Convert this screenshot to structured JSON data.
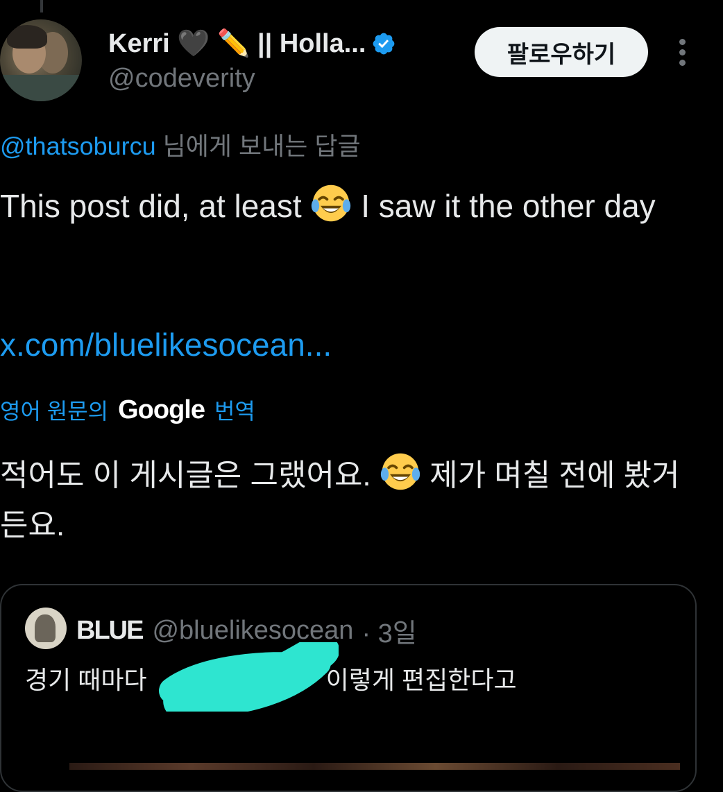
{
  "author": {
    "display_name": "Kerri 🖤 ✏️ || Holla...",
    "handle": "@codeverity",
    "verified": true
  },
  "actions": {
    "follow_label": "팔로우하기",
    "more_icon": "more-vertical-icon"
  },
  "reply": {
    "mention": "@thatsoburcu",
    "suffix": " 님에게 보내는 답글"
  },
  "tweet": {
    "text_part1": "This post did, at least ",
    "emoji": "face-with-tears-of-joy",
    "text_part2": " I saw it the other day",
    "link": "x.com/bluelikesocean..."
  },
  "translation": {
    "prefix": "영어 원문의",
    "brand": "Google",
    "suffix": "번역",
    "text_part1": "적어도 이 게시글은 그랬어요. ",
    "text_part2": " 제가 며칠 전에 봤거든요."
  },
  "quote": {
    "name": "BLUE",
    "handle": "@bluelikesocean",
    "time": "· 3일",
    "text_before": "경기 때마다",
    "text_after": "이렇게 편집한다고",
    "redaction_color": "#2ee5d0"
  },
  "colors": {
    "background": "#000000",
    "accent": "#1d9bf0",
    "text": "#e7e9ea",
    "muted": "#71767b",
    "verified_badge": "#1d9bf0"
  }
}
